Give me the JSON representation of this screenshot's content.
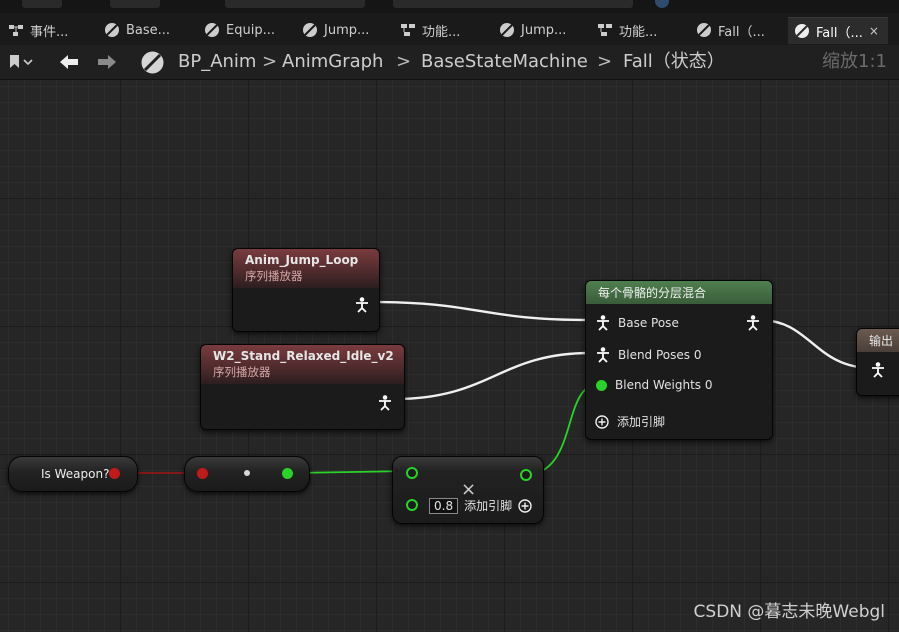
{
  "tabs": [
    {
      "label": "事件...",
      "icon": "event-graph-icon"
    },
    {
      "label": "Base...",
      "icon": "state-icon"
    },
    {
      "label": "Equip...",
      "icon": "state-icon"
    },
    {
      "label": "Jump...",
      "icon": "state-icon"
    },
    {
      "label": "功能...",
      "icon": "function-icon"
    },
    {
      "label": "Jump...",
      "icon": "state-icon"
    },
    {
      "label": "功能...",
      "icon": "function-icon"
    },
    {
      "label": "Fall（...",
      "icon": "state-icon"
    },
    {
      "label": "Fall（...",
      "icon": "state-icon",
      "active": true,
      "close": "×"
    }
  ],
  "breadcrumb": {
    "root": "BP_Anim",
    "items": [
      "AnimGraph",
      "BaseStateMachine",
      "Fall（状态）"
    ],
    "separator": ">",
    "zoom": "缩放1:1"
  },
  "nodes": {
    "jump_loop": {
      "title": "Anim_Jump_Loop",
      "subtitle": "序列播放器"
    },
    "idle": {
      "title": "W2_Stand_Relaxed_Idle_v2",
      "subtitle": "序列播放器"
    },
    "blend": {
      "title": "每个骨骼的分层混合",
      "base_pose": "Base Pose",
      "blend_poses": "Blend Poses 0",
      "blend_weights": "Blend Weights 0",
      "add_pin": "添加引脚"
    },
    "output": {
      "title": "输出"
    },
    "is_weapon": {
      "label": "Is Weapon?"
    },
    "multiply": {
      "value": "0.8",
      "add_pin": "添加引脚",
      "op": "×"
    }
  },
  "watermark": "CSDN @暮志未晚Webgl",
  "colors": {
    "exec_pose": "#ffffff",
    "float_pin": "#29d329",
    "bool_pin": "#c01a1a"
  }
}
